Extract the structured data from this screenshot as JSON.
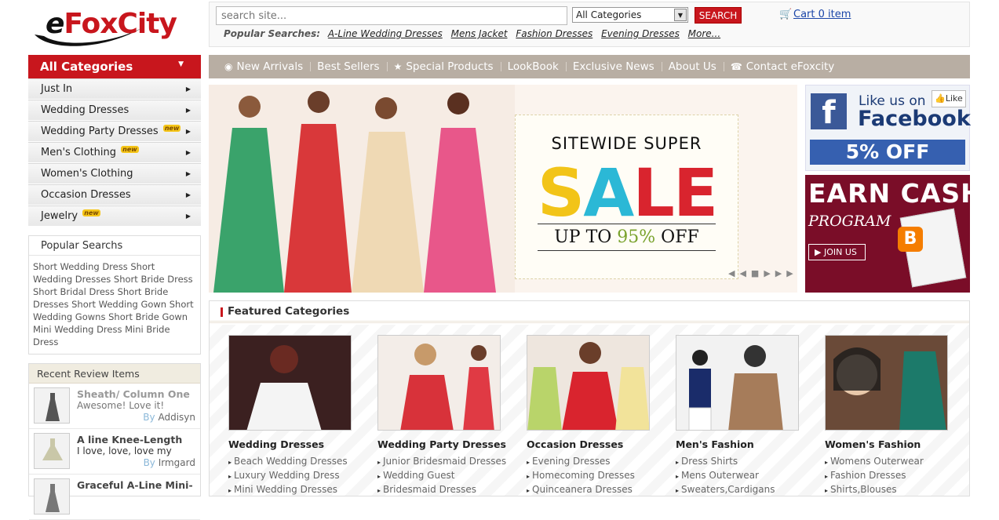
{
  "logo": {
    "text_e": "e",
    "text_rest": "FoxCity"
  },
  "search": {
    "placeholder": "search site...",
    "category": "All Categories",
    "button": "SEARCH"
  },
  "cart": {
    "label": "Cart 0 item"
  },
  "popular_searches": {
    "label": "Popular Searches:",
    "links": [
      "A-Line Wedding Dresses",
      "Mens Jacket",
      "Fashion Dresses",
      "Evening Dresses",
      "More..."
    ]
  },
  "all_categories": "All Categories",
  "topnav": [
    "New Arrivals",
    "Best Sellers",
    "Special Products",
    "LookBook",
    "Exclusive News",
    "About Us",
    "Contact eFoxcity"
  ],
  "categories": [
    {
      "label": "Just In",
      "new": ""
    },
    {
      "label": "Wedding Dresses",
      "new": ""
    },
    {
      "label": "Wedding Party Dresses",
      "new": "new"
    },
    {
      "label": "Men's Clothing",
      "new": "new"
    },
    {
      "label": "Women's Clothing",
      "new": ""
    },
    {
      "label": "Occasion Dresses",
      "new": ""
    },
    {
      "label": "Jewelry",
      "new": "new"
    }
  ],
  "popular_box": {
    "title": "Popular Searchs",
    "text": "Short Wedding Dress Short Wedding Dresses Short Bride Dress Short Bridal Dress Short Bride Dresses Short Wedding Gown Short Wedding Gowns Short Bride Gown Mini Wedding Dress Mini Bride Dress"
  },
  "reviews": {
    "title": "Recent Review Items",
    "items": [
      {
        "name": "Sheath/ Column One",
        "comment": "Awesome! Love it!",
        "by": "By",
        "user": "Addisyn"
      },
      {
        "name": "A line Knee-Length",
        "comment": "I love, love, love my",
        "by": "By",
        "user": "Irmgard"
      },
      {
        "name": "Graceful A-Line Mini-",
        "comment": "",
        "by": "",
        "user": ""
      }
    ]
  },
  "banner": {
    "top": "SITEWIDE SUPER",
    "big": "SALE",
    "sub_pre": "UP TO ",
    "sub_pct": "95%",
    "sub_post": " OFF"
  },
  "facebook": {
    "line1": "Like us on",
    "line2": "Facebook",
    "button": "Like",
    "offer": "5% OFF"
  },
  "earn": {
    "line1": "EARN CASH",
    "line2": "PROGRAM",
    "button": "JOIN US"
  },
  "featured": {
    "title": "Featured Categories",
    "columns": [
      {
        "name": "Wedding Dresses",
        "links": [
          "Beach Wedding Dresses",
          "Luxury Wedding Dress",
          "Mini Wedding Dresses"
        ]
      },
      {
        "name": "Wedding Party Dresses",
        "links": [
          "Junior Bridesmaid Dresses",
          "Wedding Guest",
          "Bridesmaid Dresses"
        ]
      },
      {
        "name": "Occasion Dresses",
        "links": [
          "Evening Dresses",
          "Homecoming Dresses",
          "Quinceanera Dresses"
        ]
      },
      {
        "name": "Men's Fashion",
        "links": [
          "Dress Shirts",
          "Mens Outerwear",
          "Sweaters,Cardigans"
        ]
      },
      {
        "name": "Women's Fashion",
        "links": [
          "Womens Outerwear",
          "Fashion Dresses",
          "Shirts,Blouses"
        ]
      }
    ]
  },
  "colors": {
    "brand_red": "#c8161d",
    "nav_bg": "#b8aea3",
    "facebook_blue": "#3b5998",
    "earn_bg": "#7a0d28"
  }
}
